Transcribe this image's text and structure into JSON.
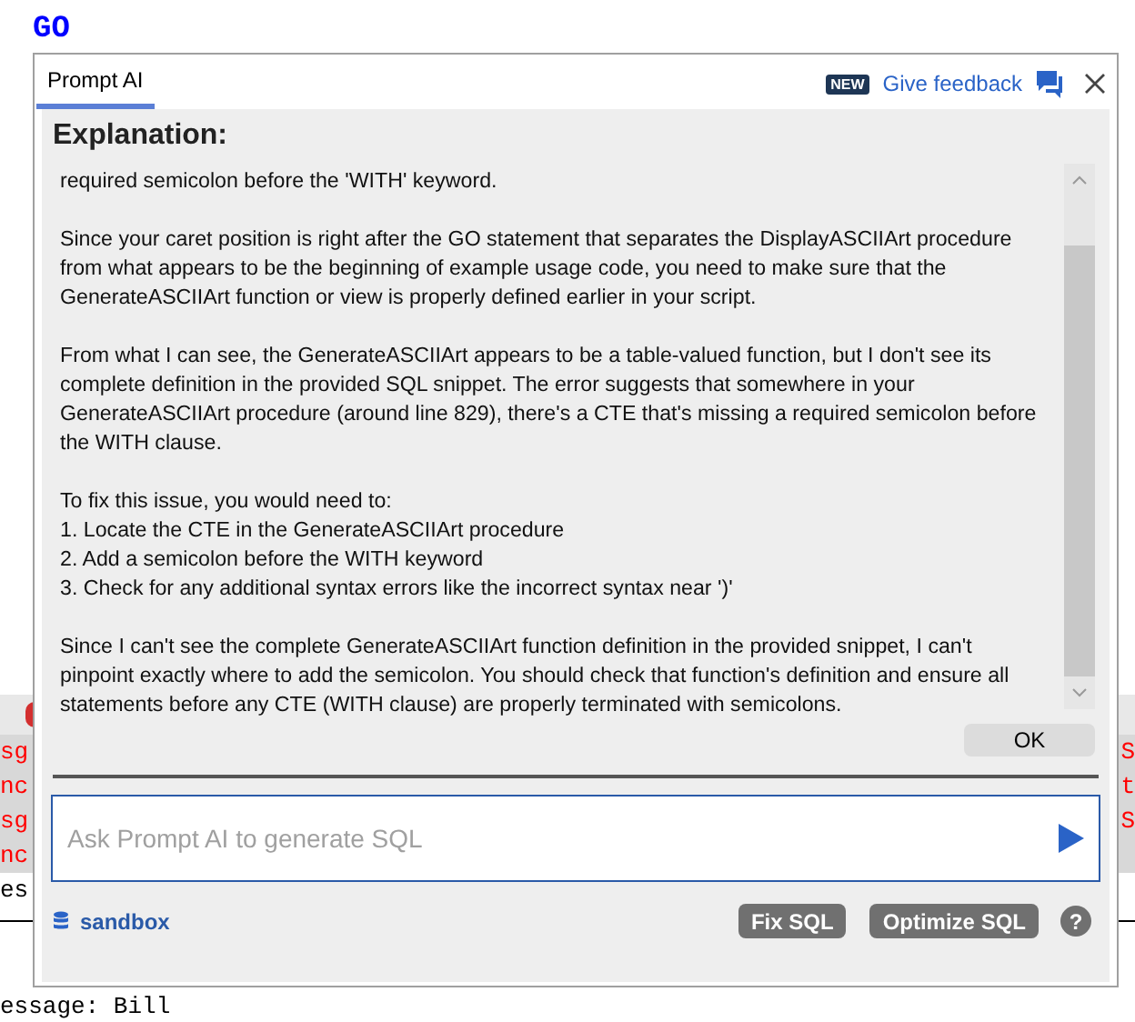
{
  "editor_top": {
    "text": "GO"
  },
  "editor_lines": [
    {
      "kind": "error"
    },
    {
      "kind": "error_text",
      "left": "sg",
      "right": "S"
    },
    {
      "kind": "error_text",
      "left": "nc",
      "right": "t"
    },
    {
      "kind": "error_text",
      "left": "sg",
      "right": "S"
    },
    {
      "kind": "error_text",
      "left": "nc"
    },
    {
      "kind": "plain",
      "left": "es"
    },
    {
      "kind": "rule"
    }
  ],
  "editor_bottom": {
    "text": "essage: Bill"
  },
  "dialog": {
    "tabs": [
      {
        "label": "Prompt AI",
        "selected": true
      }
    ],
    "badge": "NEW",
    "feedback": "Give feedback",
    "heading": "Explanation:",
    "paragraphs": [
      {
        "lines": [
          "required semicolon before the 'WITH' keyword."
        ]
      },
      {
        "lines": [
          "Since your caret position is right after the GO statement that separates the DisplayASCIIArt procedure",
          "from what appears to be the beginning of example usage code, you need to make sure that the",
          "GenerateASCIIArt function or view is properly defined earlier in your script."
        ]
      },
      {
        "lines": [
          "From what I can see, the GenerateASCIIArt appears to be a table-valued function, but I don't see its",
          "complete definition in the provided SQL snippet. The error suggests that somewhere in your",
          "GenerateASCIIArt procedure (around line 829), there's a CTE that's missing a required semicolon before",
          "the WITH clause."
        ]
      },
      {
        "lines": [
          "To fix this issue, you would need to:",
          "1. Locate the CTE in the GenerateASCIIArt procedure",
          "2. Add a semicolon before the WITH keyword",
          "3. Check for any additional syntax errors like the incorrect syntax near ')'"
        ]
      },
      {
        "lines": [
          "Since I can't see the complete GenerateASCIIArt function definition in the provided snippet, I can't",
          "pinpoint exactly where to add the semicolon. You should check that function's definition and ensure all",
          "statements before any CTE (WITH clause) are properly terminated with semicolons."
        ]
      }
    ],
    "ok_button": "OK",
    "prompt": {
      "placeholder": "Ask Prompt AI to generate SQL"
    },
    "database": "sandbox",
    "buttons": [
      "Fix SQL",
      "Optimize SQL"
    ],
    "help": "?"
  }
}
